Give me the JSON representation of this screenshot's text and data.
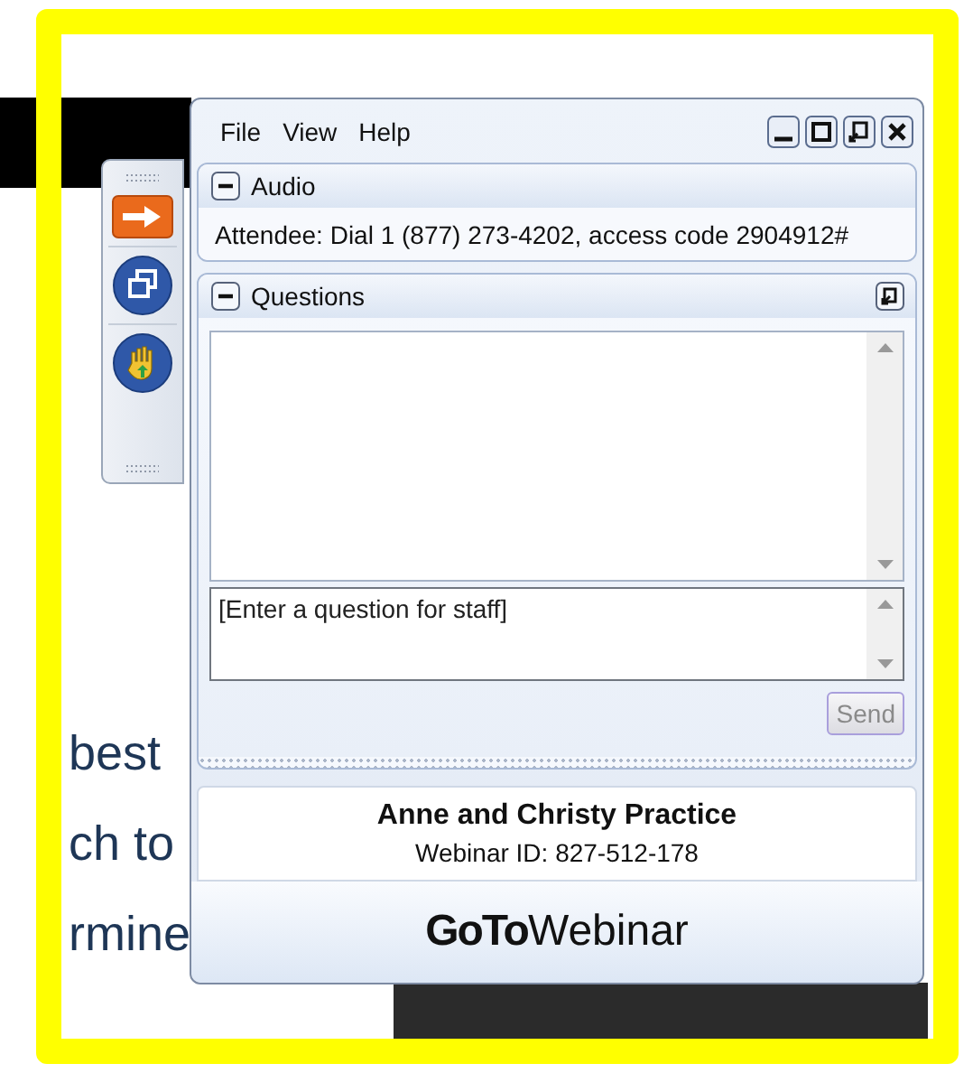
{
  "background_text": [
    "best",
    "ch to",
    "rmine"
  ],
  "menu": [
    "File",
    "View",
    "Help"
  ],
  "audio": {
    "title": "Audio",
    "expanded": true,
    "text": "Attendee: Dial 1 (877) 273-4202, access code 2904912#"
  },
  "questions": {
    "title": "Questions",
    "expanded": true,
    "placeholder": "[Enter a question for staff]",
    "send": {
      "label": "Send",
      "disabled": true
    }
  },
  "webinar": {
    "name": "Anne and Christy Practice",
    "id_line": "Webinar ID: 827-512-178"
  },
  "brand": {
    "bold": "GoTo",
    "light": "Webinar"
  }
}
